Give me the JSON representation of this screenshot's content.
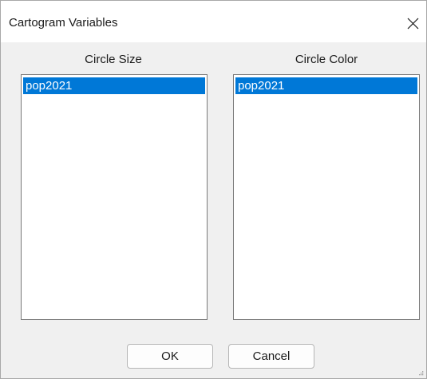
{
  "dialog": {
    "title": "Cartogram Variables",
    "close_icon": "close-icon"
  },
  "size_column": {
    "label": "Circle Size",
    "items": [
      "pop2021"
    ],
    "selected": "pop2021"
  },
  "color_column": {
    "label": "Circle Color",
    "items": [
      "pop2021"
    ],
    "selected": "pop2021"
  },
  "buttons": {
    "ok_label": "OK",
    "cancel_label": "Cancel"
  },
  "colors": {
    "selection": "#0078d7",
    "selection_text": "#ffffff",
    "dialog_bg": "#f0f0f0"
  }
}
